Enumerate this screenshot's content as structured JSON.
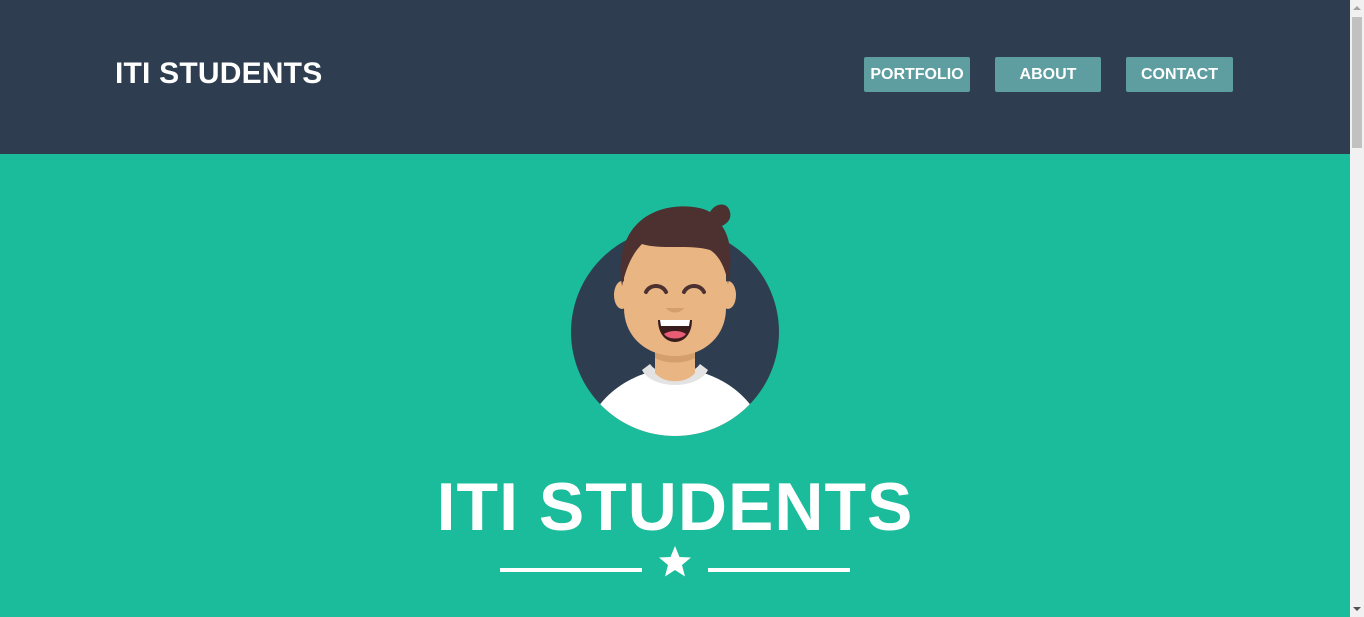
{
  "header": {
    "brand": "ITI STUDENTS",
    "nav": {
      "portfolio": "PORTFOLIO",
      "about": "ABOUT",
      "contact": "CONTACT"
    }
  },
  "hero": {
    "title": "ITI STUDENTS",
    "avatar_icon": "smiling-boy-avatar-icon",
    "divider_icon": "star-icon"
  },
  "colors": {
    "header_bg": "#2e3e50",
    "hero_bg": "#1bbc9b",
    "nav_button_bg": "#5e9ea0",
    "text": "#ffffff"
  }
}
